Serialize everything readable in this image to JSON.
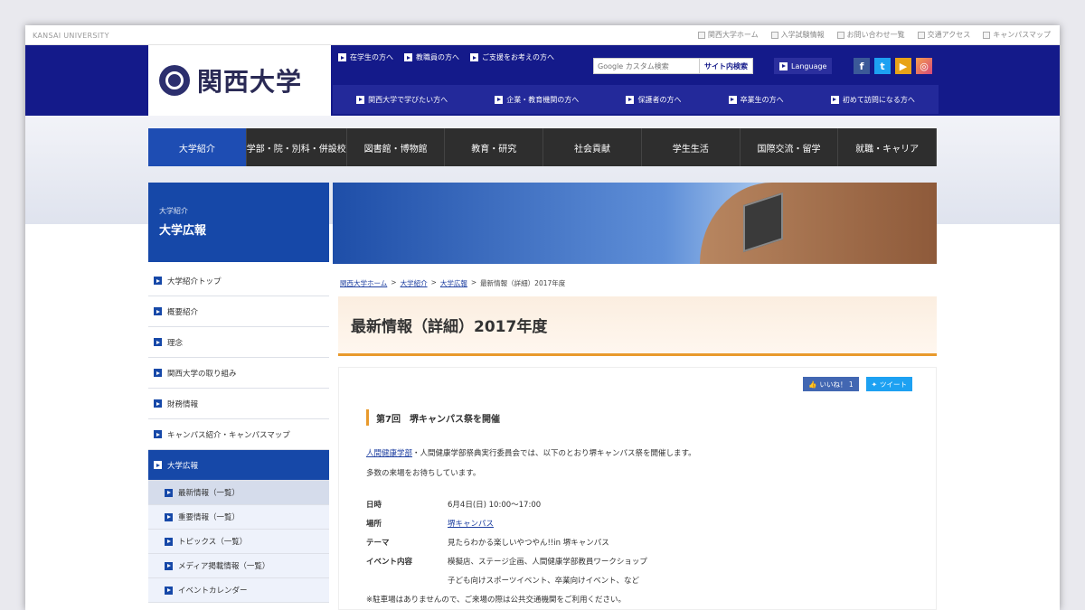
{
  "utility": {
    "brand": "KANSAI UNIVERSITY",
    "links": [
      "関西大学ホーム",
      "入学試験情報",
      "お問い合わせ一覧",
      "交通アクセス",
      "キャンパスマップ"
    ]
  },
  "header": {
    "logo_text": "関西大学",
    "nav1": [
      "在学生の方へ",
      "教職員の方へ",
      "ご支援をお考えの方へ"
    ],
    "search_placeholder": "Google カスタム検索",
    "search_button": "サイト内検索",
    "language": "Language",
    "social": [
      "facebook-icon",
      "twitter-icon",
      "youtube-icon",
      "instagram-icon"
    ],
    "nav2": [
      "関西大学で学びたい方へ",
      "企業・教育機関の方へ",
      "保護者の方へ",
      "卒業生の方へ",
      "初めて訪問になる方へ"
    ]
  },
  "gnav": [
    "大学紹介",
    "学部・院・別科・併設校",
    "図書館・博物館",
    "教育・研究",
    "社会貢献",
    "学生生活",
    "国際交流・留学",
    "就職・キャリア"
  ],
  "sidebar": {
    "sub": "大学紹介",
    "title": "大学広報",
    "items": [
      "大学紹介トップ",
      "概要紹介",
      "理念",
      "関西大学の取り組み",
      "財務情報",
      "キャンパス紹介・キャンパスマップ",
      "大学広報"
    ],
    "subitems": [
      "最新情報（一覧）",
      "重要情報（一覧）",
      "トピックス（一覧）",
      "メディア掲載情報（一覧）",
      "イベントカレンダー"
    ]
  },
  "breadcrumb": [
    "関西大学ホーム",
    "大学紹介",
    "大学広報",
    "最新情報（詳細）2017年度"
  ],
  "page_title": "最新情報（詳細）2017年度",
  "share": {
    "like": "いいね！ 1",
    "tweet": "ツイート"
  },
  "article": {
    "heading": "第7回　堺キャンパス祭を開催",
    "lead_link": "人間健康学部",
    "lead_rest": "・人間健康学部祭典実行委員会では、以下のとおり堺キャンパス祭を開催します。",
    "lead2": "多数の来場をお待ちしています。",
    "info": [
      {
        "key": "日時",
        "val": "6月4日(日) 10:00～17:00"
      },
      {
        "key": "場所",
        "val": "堺キャンパス"
      },
      {
        "key": "テーマ",
        "val": "見たらわかる楽しいやつやん!!in 堺キャンパス"
      },
      {
        "key": "イベント内容",
        "val": "模擬店、ステージ企画、人間健康学部教員ワークショップ"
      },
      {
        "key": "",
        "val": "子ども向けスポーツイベント、卒業向けイベント、など"
      }
    ],
    "note": "※駐車場はありませんので、ご来場の際は公共交通機関をご利用ください。"
  }
}
